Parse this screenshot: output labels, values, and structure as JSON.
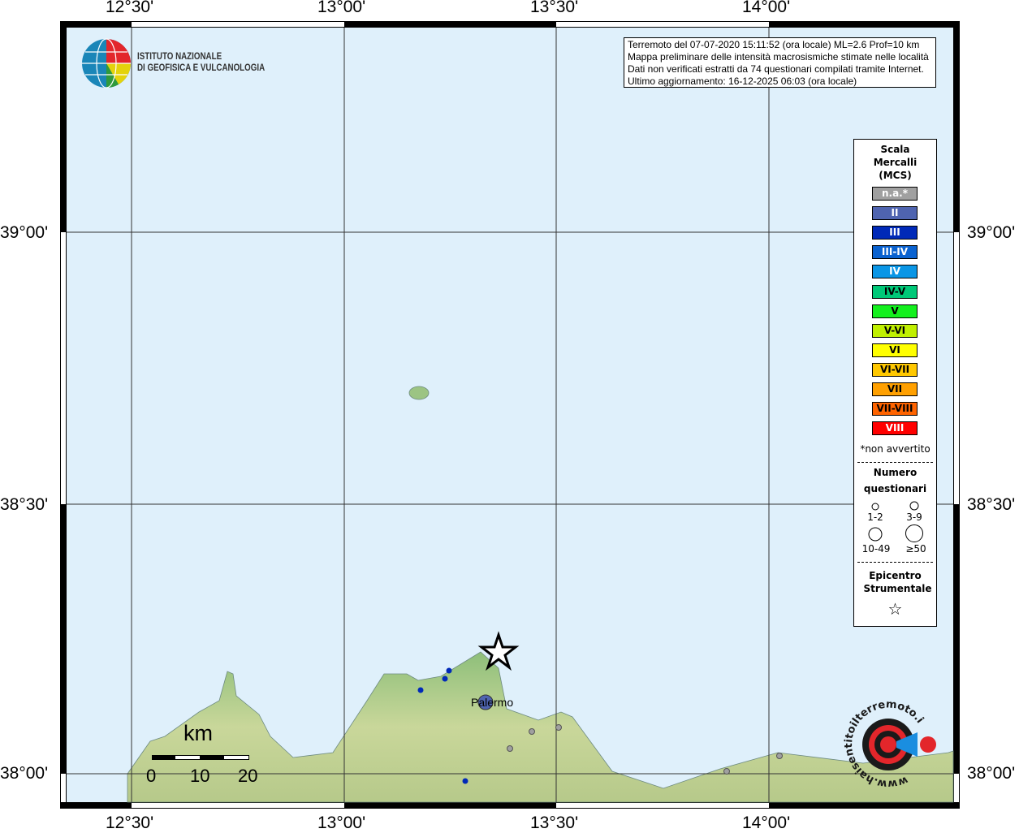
{
  "axes": {
    "lon_labels": [
      "12°30'",
      "13°00'",
      "13°30'",
      "14°00'"
    ],
    "lat_labels": [
      "39°00'",
      "38°30'",
      "38°00'"
    ]
  },
  "logo": {
    "line1": "ISTITUTO NAZIONALE",
    "line2": "DI GEOFISICA E VULCANOLOGIA"
  },
  "info": {
    "line1": "Terremoto del 07-07-2020 15:11:52 (ora locale) ML=2.6 Prof=10 km",
    "line2": "Mappa preliminare delle intensità macrosismiche stimate nelle località",
    "line3": "Dati non verificati estratti da 74 questionari compilati tramite Internet.",
    "line4": "Ultimo aggiornamento: 16-12-2025 06:03 (ora locale)"
  },
  "legend": {
    "title1": "Scala",
    "title2": "Mercalli",
    "title3": "(MCS)",
    "scale": [
      {
        "label": "n.a.*",
        "color": "#a0a0a0",
        "text": "#ffffff"
      },
      {
        "label": "II",
        "color": "#4f64b0",
        "text": "#ffffff"
      },
      {
        "label": "III",
        "color": "#0029b8",
        "text": "#ffffff"
      },
      {
        "label": "III-IV",
        "color": "#0a62d0",
        "text": "#ffffff"
      },
      {
        "label": "IV",
        "color": "#0a96e6",
        "text": "#ffffff"
      },
      {
        "label": "IV-V",
        "color": "#00c878",
        "text": "#000000"
      },
      {
        "label": "V",
        "color": "#14f01e",
        "text": "#000000"
      },
      {
        "label": "V-VI",
        "color": "#c0f000",
        "text": "#000000"
      },
      {
        "label": "VI",
        "color": "#ffff00",
        "text": "#000000"
      },
      {
        "label": "VI-VII",
        "color": "#ffc800",
        "text": "#000000"
      },
      {
        "label": "VII",
        "color": "#ffa000",
        "text": "#000000"
      },
      {
        "label": "VII-VIII",
        "color": "#ff6400",
        "text": "#000000"
      },
      {
        "label": "VIII",
        "color": "#ff0000",
        "text": "#ffffff"
      }
    ],
    "note": "*non avvertito",
    "count_title1": "Numero",
    "count_title2": "questionari",
    "counts": [
      "1-2",
      "3-9",
      "10-49",
      "≥50"
    ],
    "epi_title1": "Epicentro",
    "epi_title2": "Strumentale"
  },
  "map": {
    "city": "Palermo",
    "scalebar": {
      "unit": "km",
      "ticks": [
        "0",
        "10",
        "20"
      ]
    },
    "colors": {
      "sea": "#dff0fb",
      "land": "#9cc483"
    }
  },
  "watermark": {
    "text": "www.haisentitoilterremoto.it"
  }
}
